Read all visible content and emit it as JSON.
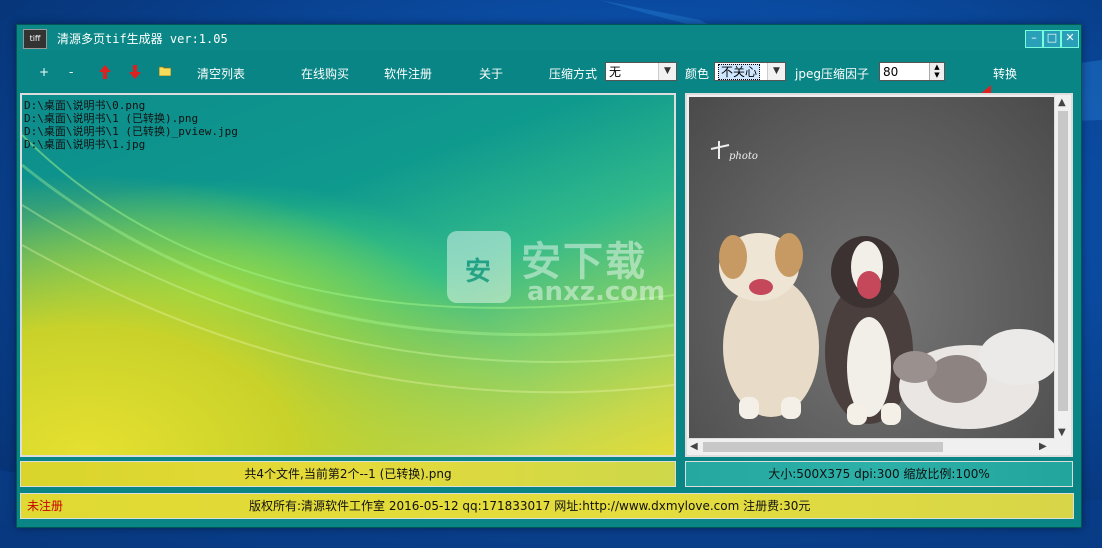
{
  "window": {
    "title": "清源多页tif生成器 ver:1.05",
    "icon_label": "tiff"
  },
  "toolbar": {
    "add_label": "+",
    "remove_label": "-",
    "clear_label": "清空列表",
    "buy_label": "在线购买",
    "register_label": "软件注册",
    "about_label": "关于",
    "compress_label": "压缩方式",
    "compress_value": "无",
    "color_label": "颜色",
    "color_value": "不关心",
    "jpeg_label": "jpeg压缩因子",
    "jpeg_value": "80",
    "convert_label": "转换"
  },
  "file_list": {
    "items": [
      "D:\\桌面\\说明书\\0.png",
      "D:\\桌面\\说明书\\1 (已转换).png",
      "D:\\桌面\\说明书\\1 (已转换)_pview.jpg",
      "D:\\桌面\\说明书\\1.jpg"
    ],
    "status": "共4个文件,当前第2个--1 (已转换).png"
  },
  "watermark": {
    "big": "安下载",
    "small": "anxz.com",
    "shield_char": "安"
  },
  "preview": {
    "status": "大小:500X375 dpi:300 缩放比例:100%",
    "photo_signature": "photo"
  },
  "footer": {
    "unregistered": "未注册",
    "copyright": "版权所有:清源软件工作室 2016-05-12 qq:171833017 网址:http://www.dxmylove.com 注册费:30元"
  },
  "colors": {
    "window_bg": "#0a8585",
    "accent_red": "#e02020",
    "unregistered_text": "#c80000"
  }
}
